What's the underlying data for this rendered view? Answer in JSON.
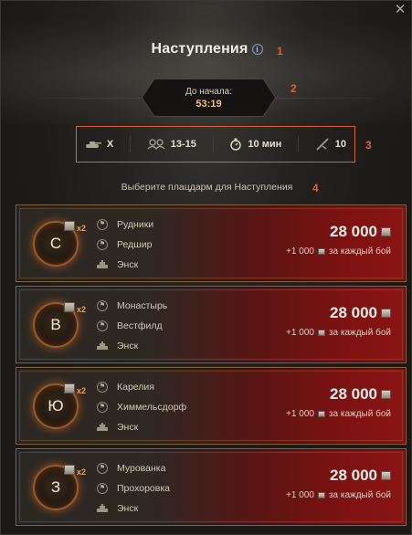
{
  "header": {
    "title": "Наступления",
    "info_icon": "info-icon",
    "close_icon": "close-icon",
    "markers": [
      "1",
      "2",
      "3",
      "4"
    ]
  },
  "timer": {
    "label": "До начала:",
    "value": "53:19"
  },
  "params": [
    {
      "icon": "tank-tier-icon",
      "value": "X"
    },
    {
      "icon": "players-icon",
      "value": "13-15"
    },
    {
      "icon": "stopwatch-icon",
      "value": "10 мин"
    },
    {
      "icon": "battles-icon",
      "value": "10"
    }
  ],
  "choose_text": "Выберите плацдарм для Наступления",
  "accent_color": "#e0622a",
  "cards": [
    {
      "letter": "С",
      "multiplier": "x2",
      "maps": [
        "Рудники",
        "Редшир",
        "Энск"
      ],
      "reward": "28 000",
      "bonus": "+1 000",
      "bonus_label": "за каждый бой"
    },
    {
      "letter": "В",
      "multiplier": "x2",
      "maps": [
        "Монастырь",
        "Вестфилд",
        "Энск"
      ],
      "reward": "28 000",
      "bonus": "+1 000",
      "bonus_label": "за каждый бой"
    },
    {
      "letter": "Ю",
      "multiplier": "x2",
      "maps": [
        "Карелия",
        "Химмельсдорф",
        "Энск"
      ],
      "reward": "28 000",
      "bonus": "+1 000",
      "bonus_label": "за каждый бой"
    },
    {
      "letter": "З",
      "multiplier": "x2",
      "maps": [
        "Мурованка",
        "Прохоровка",
        "Энск"
      ],
      "reward": "28 000",
      "bonus": "+1 000",
      "bonus_label": "за каждый бой"
    }
  ]
}
